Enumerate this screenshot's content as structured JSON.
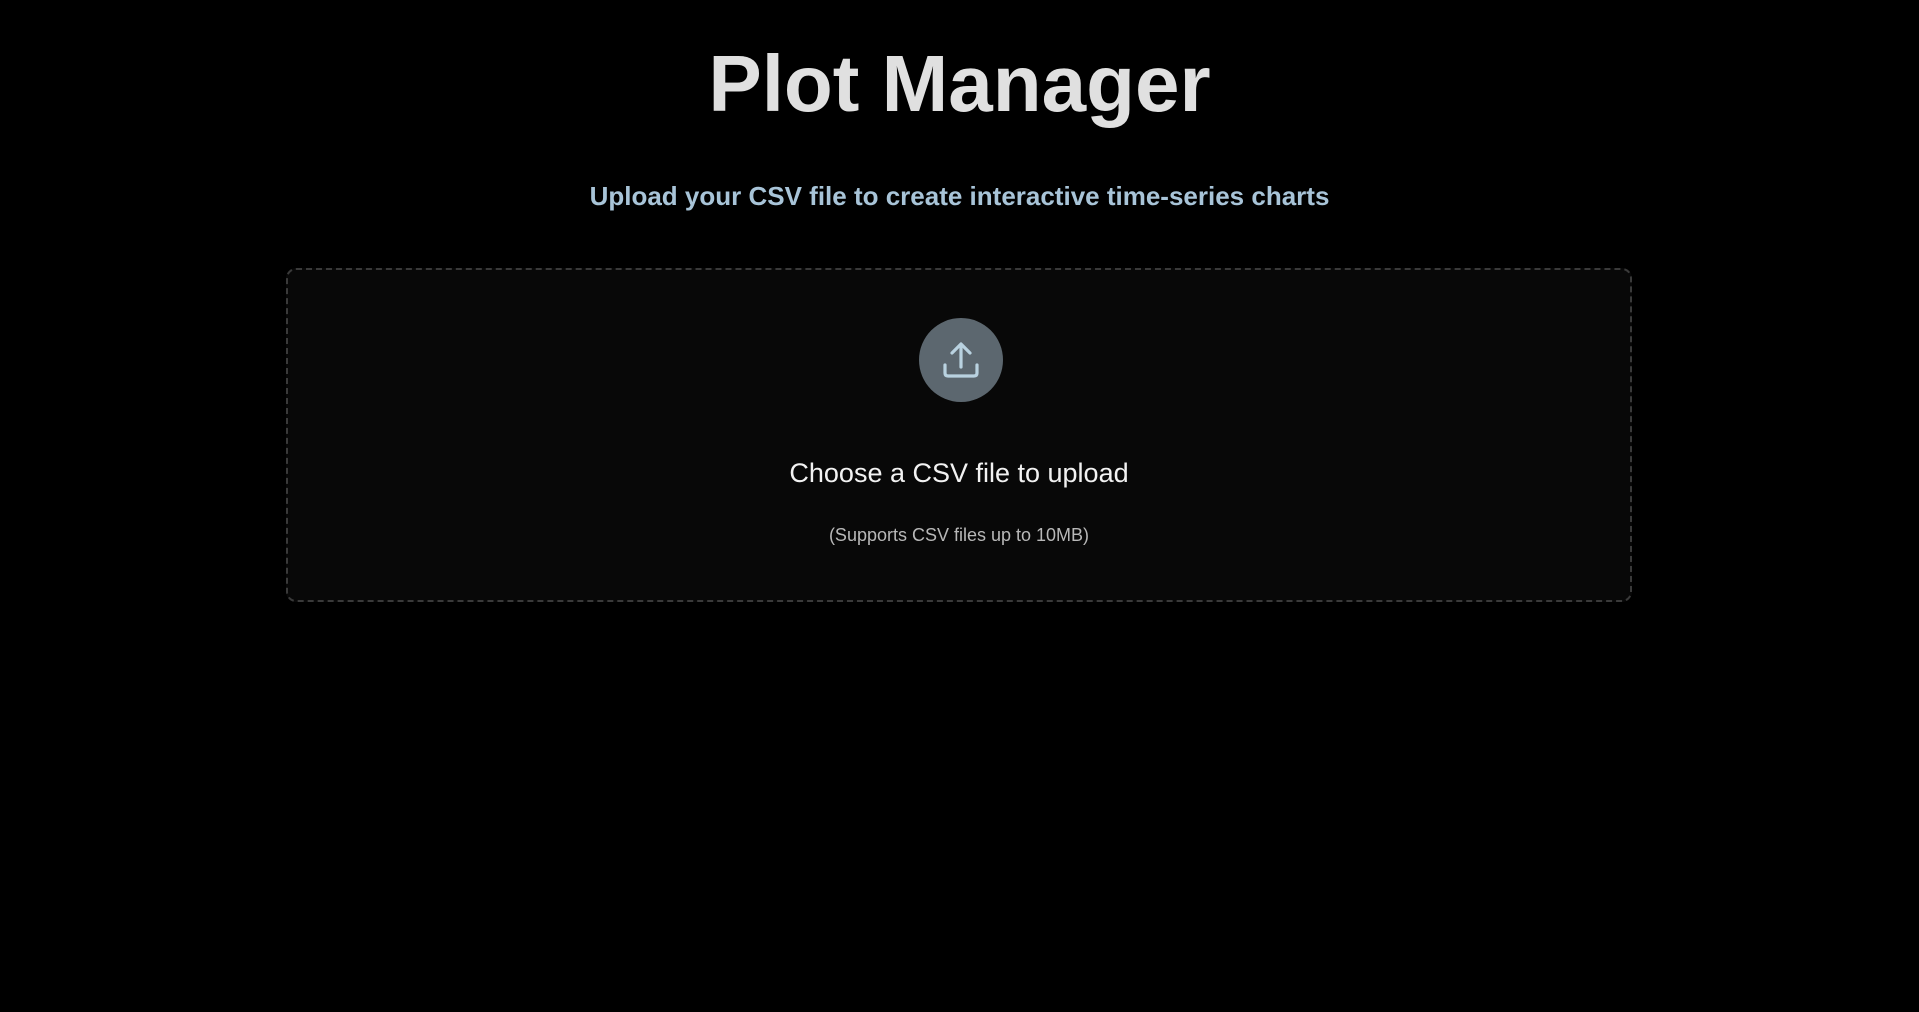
{
  "header": {
    "title": "Plot Manager",
    "subtitle": "Upload your CSV file to create interactive time-series charts"
  },
  "upload": {
    "icon": "upload-icon",
    "prompt": "Choose a CSV file to upload",
    "hint": "(Supports CSV files up to 10MB)",
    "accept": ".csv"
  },
  "colors": {
    "background": "#000000",
    "title": "#e0e0e0",
    "subtitle": "#a8c4d8",
    "icon_circle": "#5c676f",
    "icon_stroke": "#b9d2e0",
    "dropzone_border": "#3a3a3a"
  }
}
